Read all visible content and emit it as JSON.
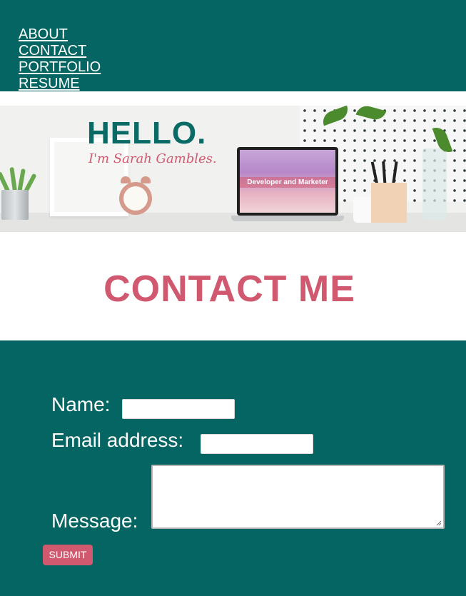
{
  "nav": {
    "items": [
      {
        "label": "ABOUT"
      },
      {
        "label": "CONTACT"
      },
      {
        "label": "PORTFOLIO"
      },
      {
        "label": "RESUME"
      }
    ]
  },
  "hero": {
    "headline": "HELLO.",
    "subheadline": "I'm Sarah Gambles.",
    "screen_text": "Developer and Marketer"
  },
  "contact": {
    "title": "CONTACT ME"
  },
  "form": {
    "name_label": "Name:",
    "name_value": "",
    "email_label": "Email address:",
    "email_value": "",
    "message_label": "Message:",
    "message_value": "",
    "submit_label": "SUBMIT"
  },
  "colors": {
    "teal": "#046562",
    "pink": "#d1596f",
    "white": "#ffffff"
  },
  "icons": {
    "resize_handle": "resize-handle-icon"
  }
}
